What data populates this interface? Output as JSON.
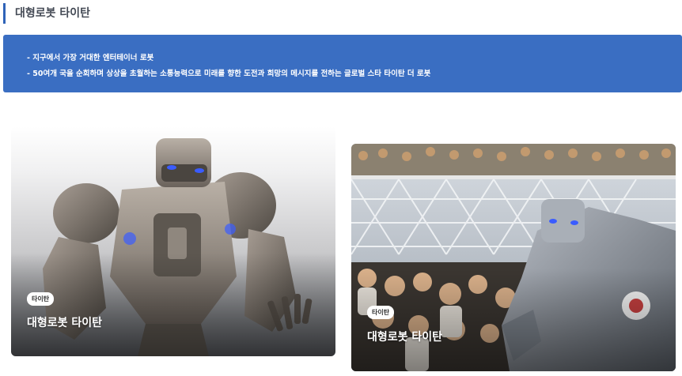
{
  "section": {
    "title": "대형로봇 타이탄"
  },
  "info": {
    "lines": [
      "- 지구에서 가장 거대한 엔터테이너 로봇",
      "- 50여개 국을 순회하며 상상을 초월하는 소통능력으로 미래를 향한 도전과 희망의 메시지를 전하는 글로벌 스타 타이탄 더 로봇"
    ]
  },
  "cards": [
    {
      "badge": "타이탄",
      "title": "대형로봇 타이탄",
      "image": "titan-robot-studio-photo"
    },
    {
      "badge": "타이탄",
      "title": "대형로봇 타이탄",
      "image": "titan-robot-crowd-photo"
    }
  ],
  "colors": {
    "accent": "#2f63b8",
    "banner": "#3a6ec2",
    "eye_glow": "#3a5cff"
  }
}
